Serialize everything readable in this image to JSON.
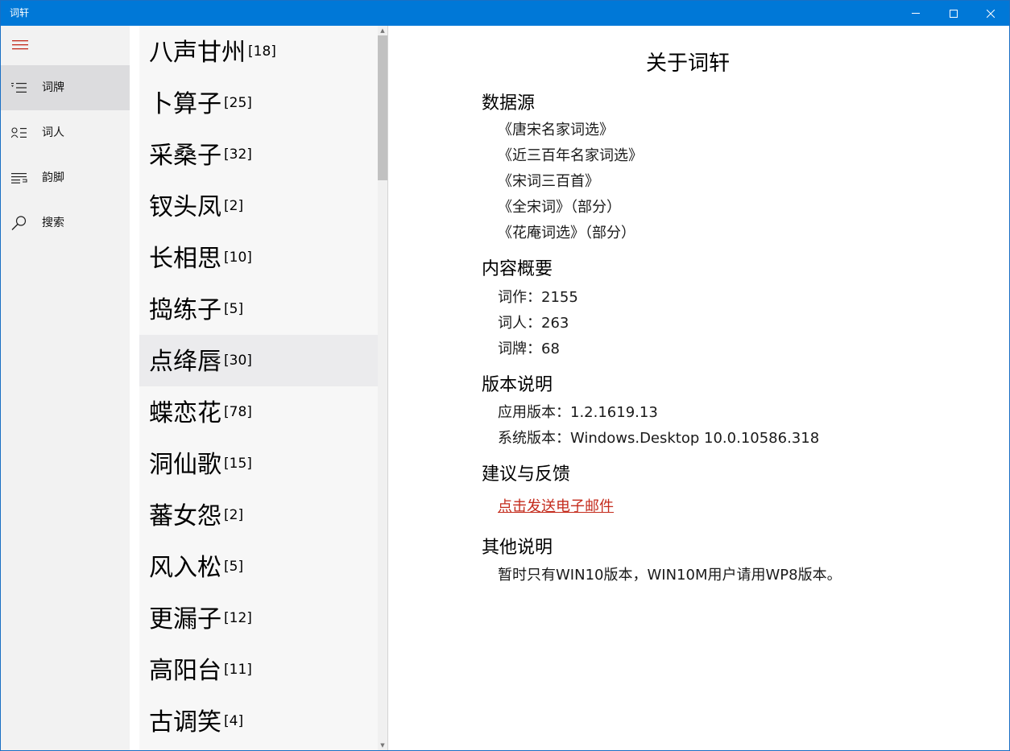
{
  "window": {
    "title": "词轩"
  },
  "nav": {
    "items": [
      {
        "label": "词牌",
        "icon": "list-icon",
        "active": true
      },
      {
        "label": "词人",
        "icon": "person-list-icon",
        "active": false
      },
      {
        "label": "韵脚",
        "icon": "rhyme-lines-icon",
        "active": false
      },
      {
        "label": "搜索",
        "icon": "search-icon",
        "active": false
      }
    ],
    "accent": "#c42b1c"
  },
  "list": {
    "items": [
      {
        "name": "八声甘州",
        "count": "[18]"
      },
      {
        "name": "卜算子",
        "count": "[25]"
      },
      {
        "name": "采桑子",
        "count": "[32]"
      },
      {
        "name": "钗头凤",
        "count": "[2]"
      },
      {
        "name": "长相思",
        "count": "[10]"
      },
      {
        "name": "捣练子",
        "count": "[5]"
      },
      {
        "name": "点绛唇",
        "count": "[30]"
      },
      {
        "name": "蝶恋花",
        "count": "[78]"
      },
      {
        "name": "洞仙歌",
        "count": "[15]"
      },
      {
        "name": "蕃女怨",
        "count": "[2]"
      },
      {
        "name": "风入松",
        "count": "[5]"
      },
      {
        "name": "更漏子",
        "count": "[12]"
      },
      {
        "name": "高阳台",
        "count": "[11]"
      },
      {
        "name": "古调笑",
        "count": "[4]"
      }
    ],
    "selected_index": 6
  },
  "about": {
    "title": "关于词轩",
    "sources": {
      "heading": "数据源",
      "lines": [
        "《唐宋名家词选》",
        "《近三百年名家词选》",
        "《宋词三百首》",
        "《全宋词》（部分）",
        "《花庵词选》（部分）"
      ]
    },
    "summary": {
      "heading": "内容概要",
      "lines": [
        "词作：2155",
        "词人：263",
        "词牌：68"
      ]
    },
    "version": {
      "heading": "版本说明",
      "lines": [
        "应用版本：1.2.1619.13",
        "系统版本：Windows.Desktop 10.0.10586.318"
      ]
    },
    "feedback": {
      "heading": "建议与反馈",
      "link": "点击发送电子邮件"
    },
    "other": {
      "heading": "其他说明",
      "lines": [
        "暂时只有WIN10版本，WIN10M用户请用WP8版本。"
      ]
    }
  }
}
